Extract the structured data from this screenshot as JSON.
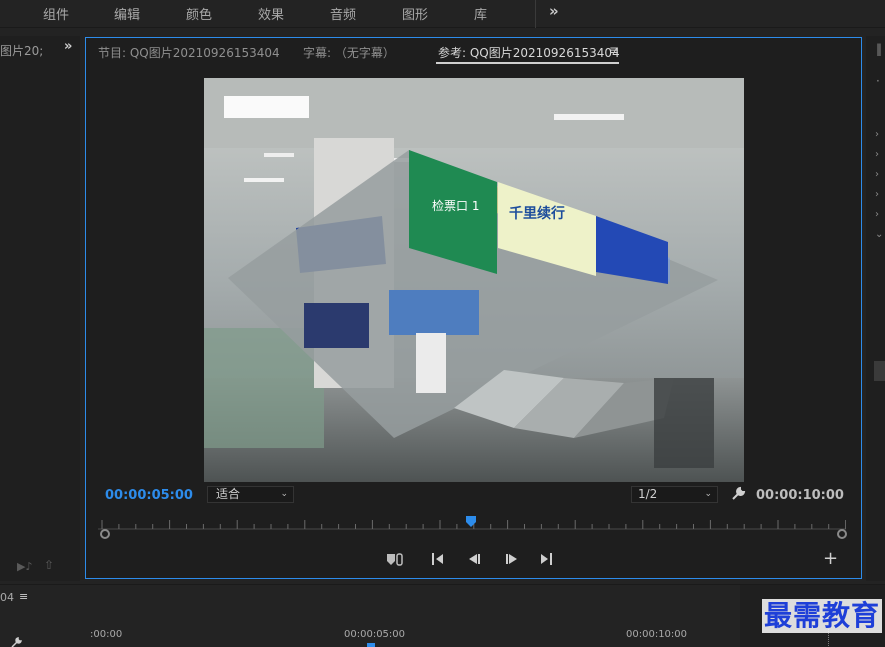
{
  "workspaces": [
    "组件",
    "编辑",
    "颜色",
    "效果",
    "音频",
    "图形",
    "库"
  ],
  "top_more": "»",
  "left_panel": {
    "title": "图片20;",
    "more": "»"
  },
  "monitor": {
    "tabs": {
      "program": "节目: QQ图片20210926153404",
      "captions": "字幕: （无字幕）",
      "reference": "参考: QQ图片20210926153404"
    },
    "tab_menu": "≡",
    "timecode_current": "00:00:05:00",
    "fit_value": "适合",
    "resolution_value": "1/2",
    "timecode_duration": "00:00:10:00",
    "add_label": "+"
  },
  "scene_signs": {
    "gate": "检票口 1",
    "ad": "千里续行"
  },
  "timeline": {
    "sequence_fragment": "04",
    "menu": "≡",
    "times": [
      ":00:00",
      "00:00:05:00",
      "00:00:10:00"
    ]
  },
  "watermark": "最需教育",
  "colors": {
    "accent": "#2d8ceb",
    "background": "#232323",
    "panel": "#1e1e1e"
  }
}
